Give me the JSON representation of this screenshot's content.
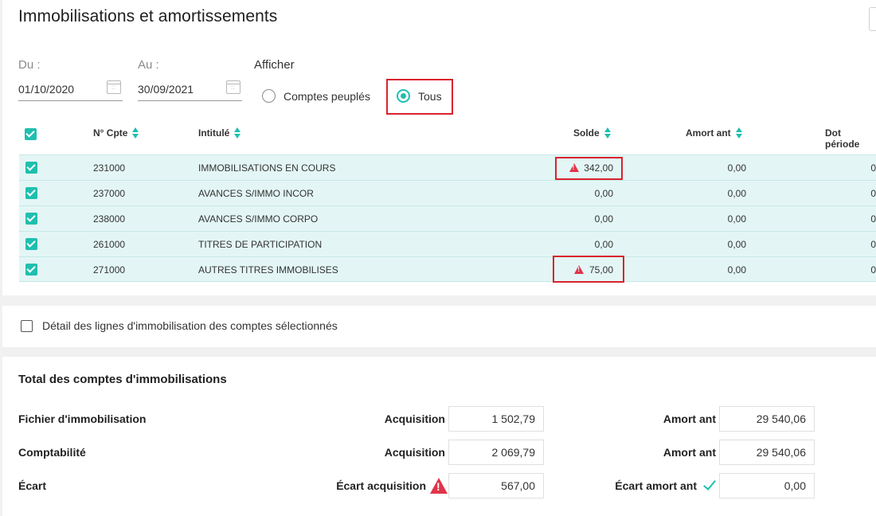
{
  "header": {
    "title": "Immobilisations et amortissements"
  },
  "filters": {
    "du_label": "Du :",
    "du_value": "01/10/2020",
    "au_label": "Au :",
    "au_value": "30/09/2021",
    "afficher_label": "Afficher",
    "options": [
      "Comptes peuplés",
      "Tous"
    ],
    "selected": "Tous"
  },
  "table": {
    "columns": [
      "N° Cpte",
      "Intitulé",
      "Solde",
      "Amort ant",
      "Dot période"
    ],
    "rows": [
      {
        "num": "231000",
        "intitule": "IMMOBILISATIONS EN COURS",
        "solde": "342,00",
        "amort": "0,00",
        "dot": "0",
        "warning": true
      },
      {
        "num": "237000",
        "intitule": "AVANCES S/IMMO INCOR",
        "solde": "0,00",
        "amort": "0,00",
        "dot": "0",
        "warning": false
      },
      {
        "num": "238000",
        "intitule": "AVANCES S/IMMO CORPO",
        "solde": "0,00",
        "amort": "0,00",
        "dot": "0",
        "warning": false
      },
      {
        "num": "261000",
        "intitule": "TITRES DE PARTICIPATION",
        "solde": "0,00",
        "amort": "0,00",
        "dot": "0",
        "warning": false
      },
      {
        "num": "271000",
        "intitule": "AUTRES TITRES IMMOBILISES",
        "solde": "75,00",
        "amort": "0,00",
        "dot": "0",
        "warning": true
      }
    ]
  },
  "detail": {
    "label": "Détail des lignes d'immobilisation des comptes sélectionnés"
  },
  "totals": {
    "title": "Total des comptes d'immobilisations",
    "rows": [
      {
        "label": "Fichier d'immobilisation",
        "acq_label": "Acquisition",
        "acq_value": "1 502,79",
        "amort_label": "Amort ant",
        "amort_value": "29 540,06"
      },
      {
        "label": "Comptabilité",
        "acq_label": "Acquisition",
        "acq_value": "2 069,79",
        "amort_label": "Amort ant",
        "amort_value": "29 540,06"
      },
      {
        "label": "Écart",
        "acq_label": "Écart acquisition",
        "acq_value": "567,00",
        "amort_label": "Écart amort ant",
        "amort_value": "0,00"
      }
    ]
  },
  "colors": {
    "accent": "#1fbfae",
    "highlight": "#d9232d",
    "warning": "#e0344a",
    "row_bg": "#e3f6f5"
  }
}
